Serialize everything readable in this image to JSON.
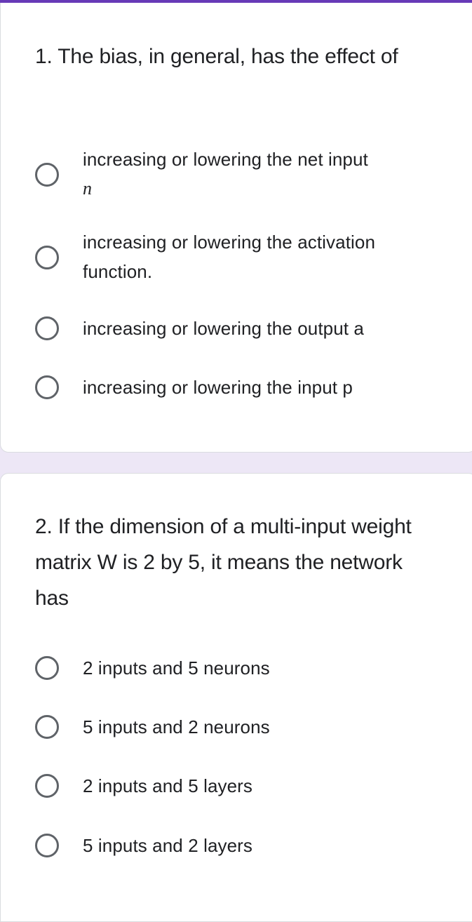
{
  "theme": {
    "accent": "#673ab7",
    "background": "#ede7f6",
    "card": "#ffffff",
    "text": "#202124",
    "radio_border": "#5f6368"
  },
  "questions": [
    {
      "number": "1.",
      "title": "1. The bias, in general, has the effect of",
      "options": [
        {
          "label": "increasing or lowering the net input",
          "math": "n",
          "selected": false
        },
        {
          "label": "increasing or lowering the activation function.",
          "selected": false
        },
        {
          "label": "increasing or lowering the output a",
          "selected": false
        },
        {
          "label": "increasing or lowering the input p",
          "selected": false
        }
      ]
    },
    {
      "number": "2.",
      "title": "2. If the dimension of a multi-input weight matrix W is 2 by 5, it means the network has",
      "options": [
        {
          "label": "2 inputs and 5 neurons",
          "selected": false
        },
        {
          "label": "5 inputs and 2 neurons",
          "selected": false
        },
        {
          "label": "2 inputs and 5 layers",
          "selected": false
        },
        {
          "label": "5 inputs and 2 layers",
          "selected": false
        }
      ]
    }
  ]
}
